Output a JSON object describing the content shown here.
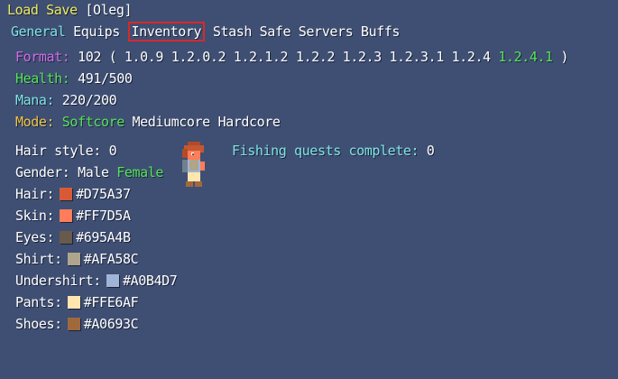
{
  "top": {
    "load": "Load",
    "save": "Save",
    "player": "[Oleg]"
  },
  "tabs": [
    "General",
    "Equips",
    "Inventory",
    "Stash",
    "Safe",
    "Servers",
    "Buffs"
  ],
  "format": {
    "label": "Format:",
    "value": "102",
    "open": "(",
    "close": ")",
    "versions": [
      "1.0.9",
      "1.2.0.2",
      "1.2.1.2",
      "1.2.2",
      "1.2.3",
      "1.2.3.1",
      "1.2.4",
      "1.2.4.1"
    ]
  },
  "health": {
    "label": "Health:",
    "value": "491/500"
  },
  "mana": {
    "label": "Mana:",
    "value": "220/200"
  },
  "mode": {
    "label": "Mode:",
    "options": [
      "Softcore",
      "Mediumcore",
      "Hardcore"
    ]
  },
  "hair_style": {
    "label": "Hair style:",
    "value": "0"
  },
  "gender": {
    "label": "Gender:",
    "options": [
      "Male",
      "Female"
    ]
  },
  "fishing": {
    "label": "Fishing quests complete:",
    "value": "0"
  },
  "colors": {
    "hair": {
      "label": "Hair:",
      "hex": "#D75A37",
      "swatch": "#D75A37"
    },
    "skin": {
      "label": "Skin:",
      "hex": "#FF7D5A",
      "swatch": "#FF7D5A"
    },
    "eyes": {
      "label": "Eyes:",
      "hex": "#695A4B",
      "swatch": "#695A4B"
    },
    "shirt": {
      "label": "Shirt:",
      "hex": "#AFA58C",
      "swatch": "#AFA58C"
    },
    "undershirt": {
      "label": "Undershirt:",
      "hex": "#A0B4D7",
      "swatch": "#A0B4D7"
    },
    "pants": {
      "label": "Pants:",
      "hex": "#FFE6AF",
      "swatch": "#FFE6AF"
    },
    "shoes": {
      "label": "Shoes:",
      "hex": "#A0693C",
      "swatch": "#A0693C"
    }
  }
}
